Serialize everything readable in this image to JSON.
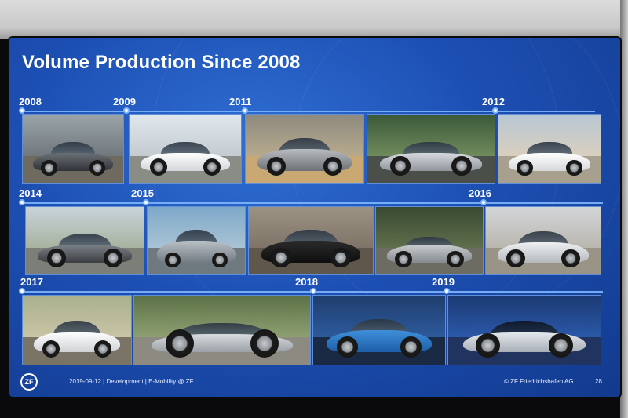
{
  "slide": {
    "title": "Volume Production Since 2008",
    "years": [
      "2008",
      "2009",
      "2011",
      "2012",
      "2014",
      "2015",
      "2016",
      "2017",
      "2018",
      "2019"
    ],
    "footer": {
      "logo": "ZF",
      "left": "2019-09-12 | Development | E-Mobility @ ZF",
      "right": "© ZF Friedrichshafen AG",
      "page": "28"
    }
  },
  "colors": {
    "slide_bg": "#1d4fb3",
    "timeline": "#7fb6ff",
    "text": "#ffffff"
  }
}
